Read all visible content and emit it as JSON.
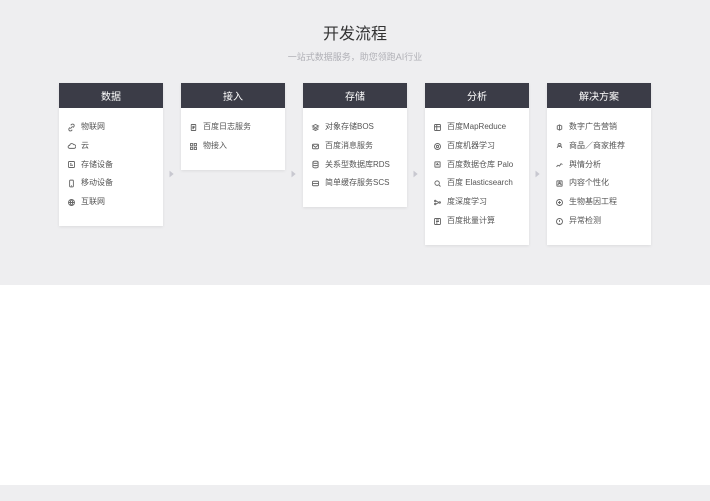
{
  "title": "开发流程",
  "subtitle": "一站式数据服务，助您领跑AI行业",
  "columns": [
    {
      "header": "数据",
      "items": [
        {
          "icon": "link",
          "label": "物联网"
        },
        {
          "icon": "cloud",
          "label": "云"
        },
        {
          "icon": "storage",
          "label": "存储设备"
        },
        {
          "icon": "mobile",
          "label": "移动设备"
        },
        {
          "icon": "globe",
          "label": "互联网"
        }
      ]
    },
    {
      "header": "接入",
      "items": [
        {
          "icon": "doc",
          "label": "百度日志服务"
        },
        {
          "icon": "grid",
          "label": "物接入"
        }
      ]
    },
    {
      "header": "存储",
      "items": [
        {
          "icon": "stack",
          "label": "对象存储BOS"
        },
        {
          "icon": "msg",
          "label": "百度消息服务"
        },
        {
          "icon": "db",
          "label": "关系型数据库RDS"
        },
        {
          "icon": "cache",
          "label": "简单缓存服务SCS"
        }
      ]
    },
    {
      "header": "分析",
      "items": [
        {
          "icon": "map",
          "label": "百度MapReduce"
        },
        {
          "icon": "ml",
          "label": "百度机器学习"
        },
        {
          "icon": "dw",
          "label": "百度数据仓库 Palo"
        },
        {
          "icon": "es",
          "label": "百度 Elasticsearch"
        },
        {
          "icon": "dl",
          "label": "度深度学习"
        },
        {
          "icon": "batch",
          "label": "百度批量计算"
        }
      ]
    },
    {
      "header": "解决方案",
      "items": [
        {
          "icon": "ad",
          "label": "数字广告营销"
        },
        {
          "icon": "rec",
          "label": "商品／商家推荐"
        },
        {
          "icon": "sent",
          "label": "舆情分析"
        },
        {
          "icon": "pers",
          "label": "内容个性化"
        },
        {
          "icon": "bio",
          "label": "生物基因工程"
        },
        {
          "icon": "anom",
          "label": "异常检测"
        }
      ]
    }
  ]
}
